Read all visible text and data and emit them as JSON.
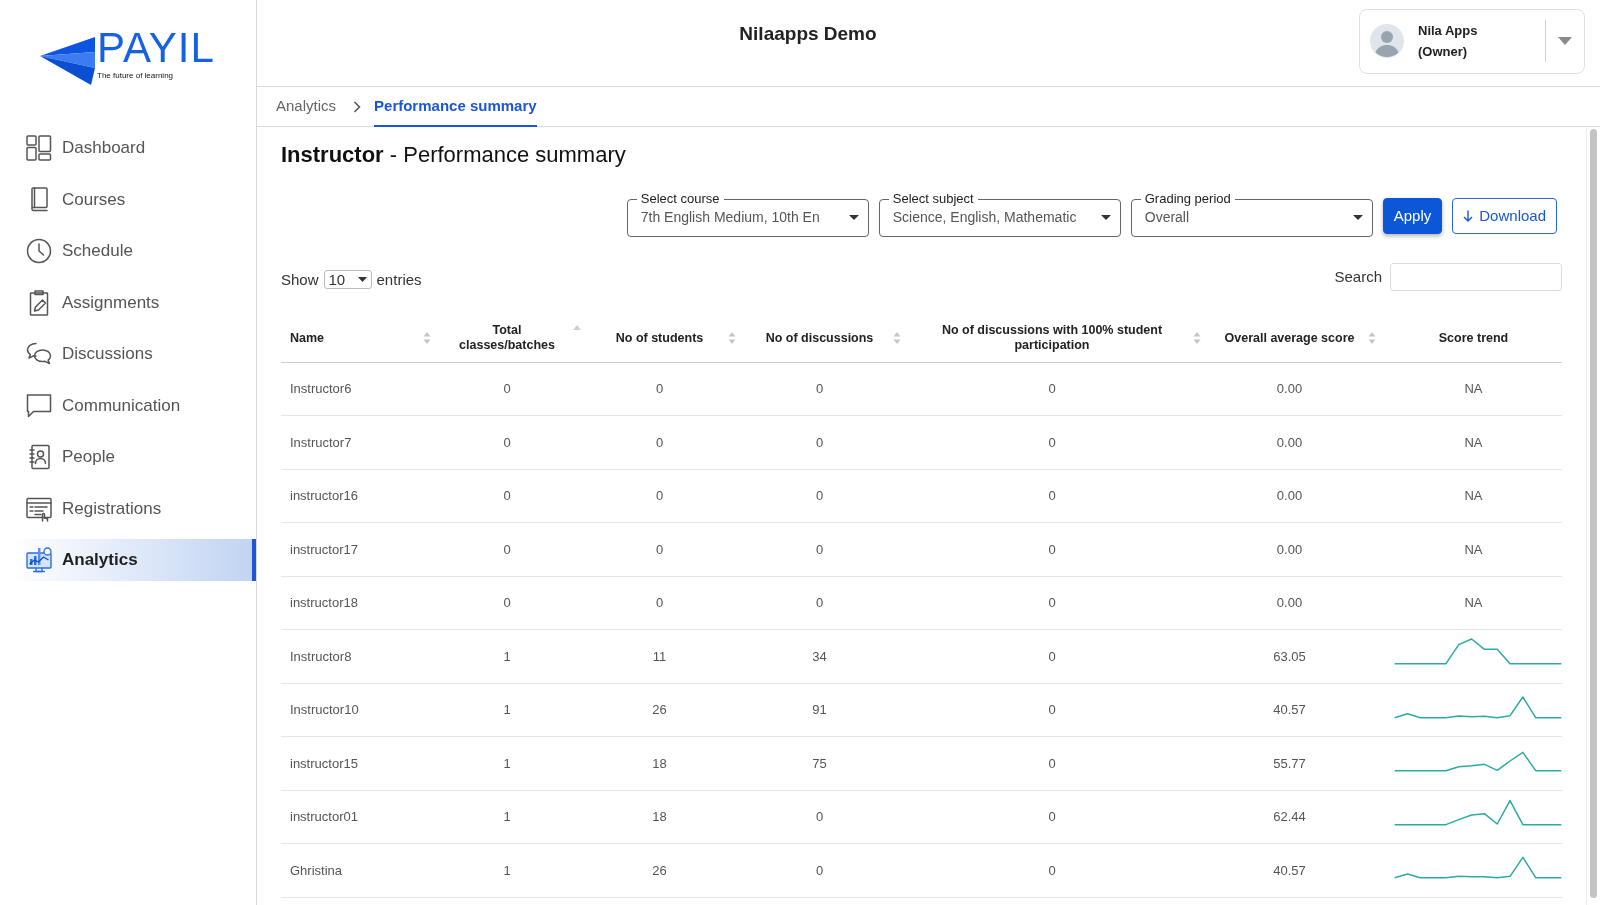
{
  "sidebar": {
    "logo": {
      "wordmark": "PAYIL",
      "tagline": "The future of learning"
    },
    "items": [
      {
        "label": "Dashboard",
        "selected": false
      },
      {
        "label": "Courses",
        "selected": false
      },
      {
        "label": "Schedule",
        "selected": false
      },
      {
        "label": "Assignments",
        "selected": false
      },
      {
        "label": "Discussions",
        "selected": false
      },
      {
        "label": "Communication",
        "selected": false
      },
      {
        "label": "People",
        "selected": false
      },
      {
        "label": "Registrations",
        "selected": false
      },
      {
        "label": "Analytics",
        "selected": true
      }
    ]
  },
  "header": {
    "title": "Nilaapps Demo",
    "user": {
      "name": "Nila Apps",
      "role": "(Owner)"
    }
  },
  "breadcrumb": [
    {
      "label": "Analytics",
      "selected": false
    },
    {
      "label": "Performance summary",
      "selected": true
    }
  ],
  "page_title": "**Instructor** - Performance summary",
  "filters": [
    {
      "label": "Select course",
      "value": "7th English Medium, 10th En"
    },
    {
      "label": "Select subject",
      "value": "Science, English, Mathematic"
    },
    {
      "label": "Grading period",
      "value": "Overall"
    }
  ],
  "buttons": [
    {
      "kind": "primary",
      "label": "Apply"
    },
    {
      "kind": "download",
      "label": "Download"
    }
  ],
  "table": {
    "length": {
      "before": "Show",
      "value": "10",
      "after": "entries"
    },
    "search": {
      "label": "Search"
    },
    "columns": [
      {
        "label": "Name",
        "sortable": true,
        "sorted": false
      },
      {
        "label": "Total classes/batches",
        "sortable": true,
        "sorted": true
      },
      {
        "label": "No of students",
        "sortable": true,
        "sorted": false
      },
      {
        "label": "No of discussions",
        "sortable": true,
        "sorted": false
      },
      {
        "label": "No of discussions with 100% student participation",
        "sortable": true,
        "sorted": false
      },
      {
        "label": "Overall average score",
        "sortable": true,
        "sorted": false
      },
      {
        "label": "Score trend",
        "sortable": false,
        "sorted": false
      }
    ],
    "rows": [
      {
        "name": "Instructor6",
        "classes": "0",
        "students": "0",
        "discussions": "0",
        "full_participation": "0",
        "average": "0.00",
        "trend": {
          "kind": "text",
          "text": "NA"
        }
      },
      {
        "name": "Instructor7",
        "classes": "0",
        "students": "0",
        "discussions": "0",
        "full_participation": "0",
        "average": "0.00",
        "trend": {
          "kind": "text",
          "text": "NA"
        }
      },
      {
        "name": "instructor16",
        "classes": "0",
        "students": "0",
        "discussions": "0",
        "full_participation": "0",
        "average": "0.00",
        "trend": {
          "kind": "text",
          "text": "NA"
        }
      },
      {
        "name": "instructor17",
        "classes": "0",
        "students": "0",
        "discussions": "0",
        "full_participation": "0",
        "average": "0.00",
        "trend": {
          "kind": "text",
          "text": "NA"
        }
      },
      {
        "name": "instructor18",
        "classes": "0",
        "students": "0",
        "discussions": "0",
        "full_participation": "0",
        "average": "0.00",
        "trend": {
          "kind": "text",
          "text": "NA"
        }
      },
      {
        "name": "Instructor8",
        "classes": "1",
        "students": "11",
        "discussions": "34",
        "full_participation": "0",
        "average": "63.05",
        "trend": {
          "kind": "sparkline"
        }
      },
      {
        "name": "Instructor10",
        "classes": "1",
        "students": "26",
        "discussions": "91",
        "full_participation": "0",
        "average": "40.57",
        "trend": {
          "kind": "sparkline"
        }
      },
      {
        "name": "instructor15",
        "classes": "1",
        "students": "18",
        "discussions": "75",
        "full_participation": "0",
        "average": "55.77",
        "trend": {
          "kind": "sparkline"
        }
      },
      {
        "name": "instructor01",
        "classes": "1",
        "students": "18",
        "discussions": "0",
        "full_participation": "0",
        "average": "62.44",
        "trend": {
          "kind": "sparkline"
        }
      },
      {
        "name": "Ghristina",
        "classes": "1",
        "students": "26",
        "discussions": "0",
        "full_participation": "0",
        "average": "40.57",
        "trend": {
          "kind": "sparkline"
        }
      }
    ]
  }
}
